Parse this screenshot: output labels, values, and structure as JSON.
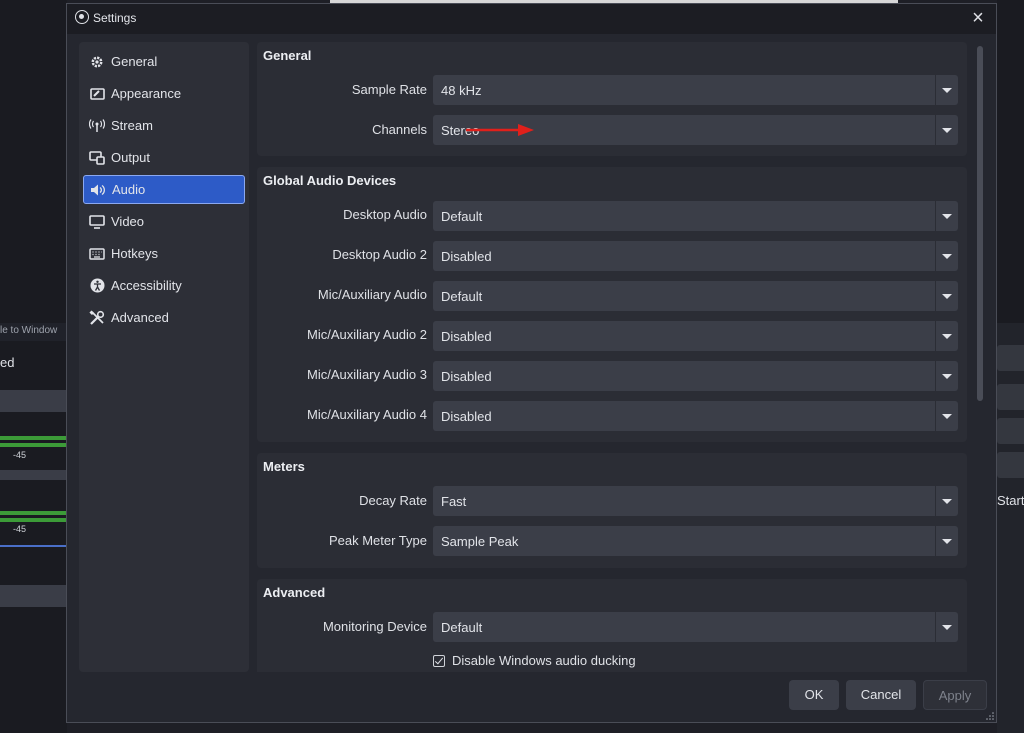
{
  "background": {
    "left_label": "le to Window",
    "left_label2": "ed",
    "meter_tick_1": "-45",
    "meter_tick_2": "-45",
    "right_label": "Start"
  },
  "dialog": {
    "title": "Settings",
    "close_icon": "close-icon",
    "sidebar": {
      "items": [
        {
          "label": "General",
          "icon": "gear-icon"
        },
        {
          "label": "Appearance",
          "icon": "appearance-icon"
        },
        {
          "label": "Stream",
          "icon": "antenna-icon"
        },
        {
          "label": "Output",
          "icon": "output-icon"
        },
        {
          "label": "Audio",
          "icon": "speaker-icon",
          "active": true
        },
        {
          "label": "Video",
          "icon": "monitor-icon"
        },
        {
          "label": "Hotkeys",
          "icon": "keyboard-icon"
        },
        {
          "label": "Accessibility",
          "icon": "accessibility-icon"
        },
        {
          "label": "Advanced",
          "icon": "tools-icon"
        }
      ]
    },
    "general": {
      "title": "General",
      "sample_rate": {
        "label": "Sample Rate",
        "value": "48 kHz"
      },
      "channels": {
        "label": "Channels",
        "value": "Stereo"
      }
    },
    "global_audio": {
      "title": "Global Audio Devices",
      "rows": [
        {
          "label": "Desktop Audio",
          "value": "Default"
        },
        {
          "label": "Desktop Audio 2",
          "value": "Disabled"
        },
        {
          "label": "Mic/Auxiliary Audio",
          "value": "Default"
        },
        {
          "label": "Mic/Auxiliary Audio 2",
          "value": "Disabled"
        },
        {
          "label": "Mic/Auxiliary Audio 3",
          "value": "Disabled"
        },
        {
          "label": "Mic/Auxiliary Audio 4",
          "value": "Disabled"
        }
      ]
    },
    "meters": {
      "title": "Meters",
      "decay_rate": {
        "label": "Decay Rate",
        "value": "Fast"
      },
      "peak_meter_type": {
        "label": "Peak Meter Type",
        "value": "Sample Peak"
      }
    },
    "advanced": {
      "title": "Advanced",
      "monitoring_device": {
        "label": "Monitoring Device",
        "value": "Default"
      },
      "ducking": {
        "label": "Disable Windows audio ducking",
        "checked": true
      }
    },
    "buttons": {
      "ok": "OK",
      "cancel": "Cancel",
      "apply": "Apply"
    },
    "colors": {
      "accent": "#2d5bc7",
      "annotation_arrow": "#e0201b"
    }
  }
}
